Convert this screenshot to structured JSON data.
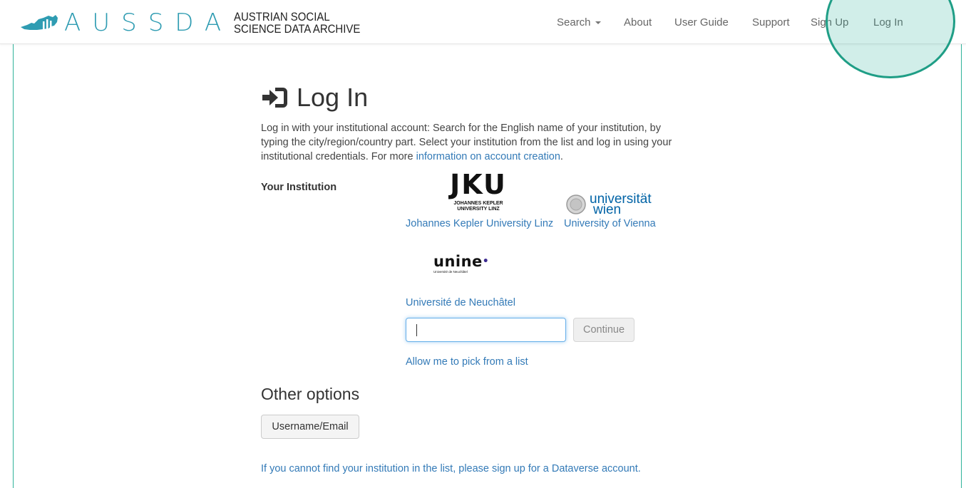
{
  "brand": {
    "letters": "AUSSDA",
    "subtitle_line1": "AUSTRIAN SOCIAL",
    "subtitle_line2": "SCIENCE DATA ARCHIVE"
  },
  "nav": {
    "search": "Search",
    "about": "About",
    "user_guide": "User Guide",
    "support": "Support",
    "sign_up": "Sign Up",
    "log_in": "Log In"
  },
  "page": {
    "title": "Log In",
    "intro_text": "Log in with your institutional account: Search for the English name of your institution, by typing the city/region/country part. Select your institution from the list and log in using your institutional credentials. For more ",
    "intro_link": "information on account creation",
    "intro_end": "."
  },
  "institutions": {
    "label": "Your Institution",
    "items": [
      {
        "name": "Johannes Kepler University Linz",
        "logo_main": "JKU",
        "logo_sub1": "JOHANNES KEPLER",
        "logo_sub2": "UNIVERSITY LINZ"
      },
      {
        "name": "University of Vienna",
        "logo_line1": "universität",
        "logo_line2": "wien"
      },
      {
        "name": "Université de Neuchâtel",
        "logo_main": "unine",
        "logo_sub": "Université de Neuchâtel"
      }
    ],
    "search_value": "",
    "continue_label": "Continue",
    "pick_list_link": "Allow me to pick from a list"
  },
  "other_options": {
    "title": "Other options",
    "username_button": "Username/Email",
    "bottom_link": "If you cannot find your institution in the list, please sign up for a Dataverse account."
  },
  "colors": {
    "accent": "#2fb39a",
    "brand_blue": "#2f9cb2",
    "link": "#337ab7"
  }
}
